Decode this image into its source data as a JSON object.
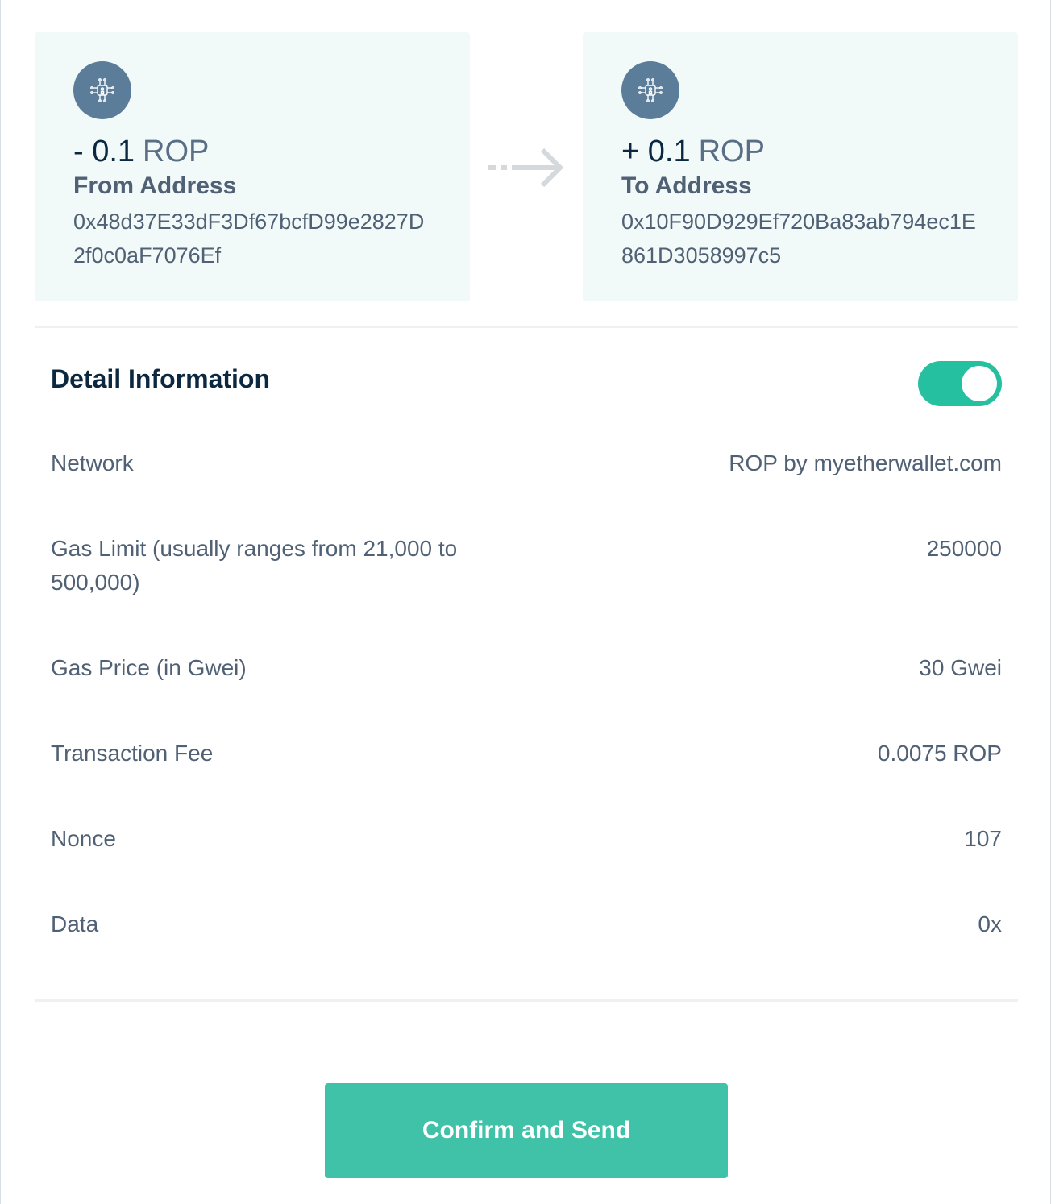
{
  "from": {
    "amount_sign": "- 0.1",
    "currency": "ROP",
    "label": "From Address",
    "address": "0x48d37E33dF3Df67bcfD99e2827D2f0c0aF7076Ef",
    "avatar_icon": "blockchain-chip-icon"
  },
  "to": {
    "amount_sign": "+ 0.1",
    "currency": "ROP",
    "label": "To Address",
    "address": "0x10F90D929Ef720Ba83ab794ec1E861D3058997c5",
    "avatar_icon": "blockchain-chip-icon"
  },
  "arrow_icon": "right-arrow-icon",
  "detail": {
    "title": "Detail Information",
    "toggle_on": true,
    "rows": [
      {
        "label": "Network",
        "value": "ROP by myetherwallet.com"
      },
      {
        "label": "Gas Limit (usually ranges from 21,000 to 500,000)",
        "value": "250000"
      },
      {
        "label": "Gas Price (in Gwei)",
        "value": "30 Gwei"
      },
      {
        "label": "Transaction Fee",
        "value": "0.0075 ROP"
      },
      {
        "label": "Nonce",
        "value": "107"
      },
      {
        "label": "Data",
        "value": "0x"
      }
    ]
  },
  "confirm_label": "Confirm and Send",
  "colors": {
    "accent": "#25c0a0",
    "button": "#3fc2a8",
    "card_bg": "#f2faf9",
    "avatar_bg": "#5b7d9a",
    "heading": "#0b2840",
    "text": "#506175"
  }
}
